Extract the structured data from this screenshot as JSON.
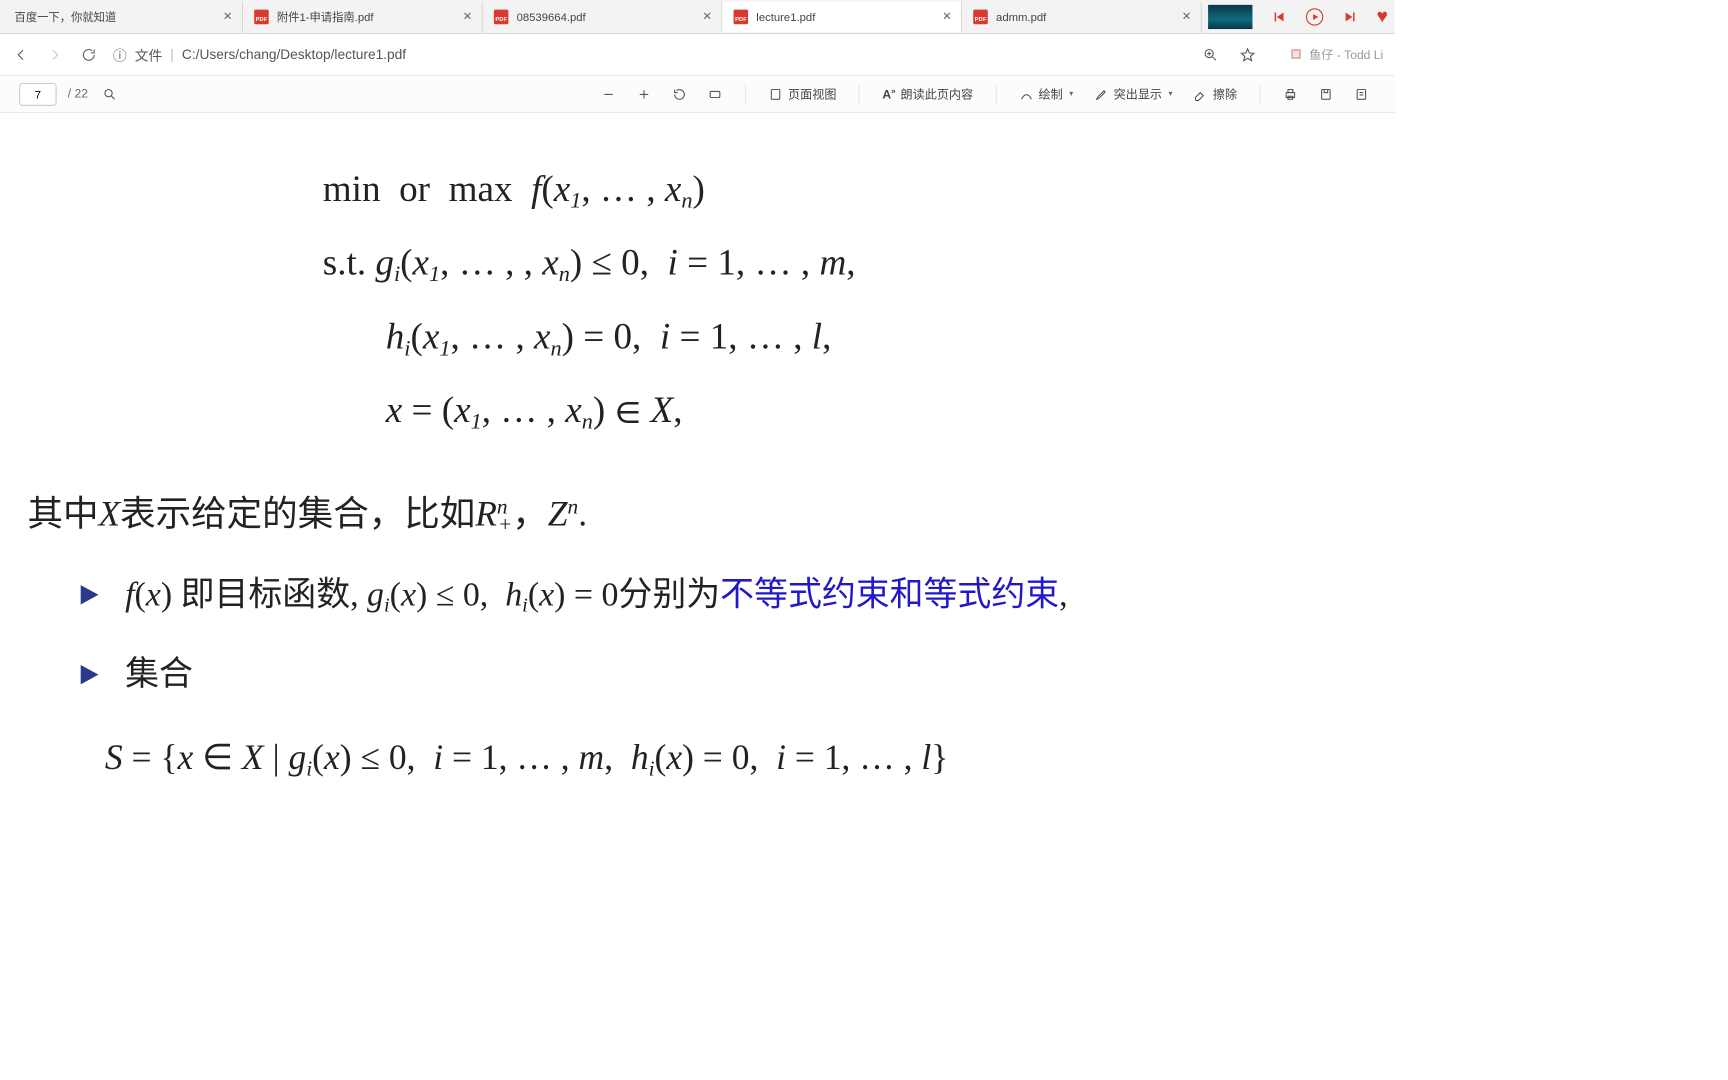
{
  "tabs": [
    {
      "label": "百度一下，你就知道",
      "has_pdf_icon": false
    },
    {
      "label": "附件1-申请指南.pdf",
      "has_pdf_icon": true
    },
    {
      "label": "08539664.pdf",
      "has_pdf_icon": true
    },
    {
      "label": "lecture1.pdf",
      "has_pdf_icon": true,
      "active": true
    },
    {
      "label": "admm.pdf",
      "has_pdf_icon": true
    }
  ],
  "address": {
    "info_label": "文件",
    "url": "C:/Users/chang/Desktop/lecture1.pdf"
  },
  "music": {
    "title": "鱼仔",
    "artist": "Todd Li"
  },
  "pdf_toolbar": {
    "page": "7",
    "page_count": "/ 22",
    "page_view": "页面视图",
    "read_aloud": "朗读此页内容",
    "draw": "绘制",
    "highlight": "突出显示",
    "erase": "擦除"
  },
  "content": {
    "math": [
      "min  or  max  f(x₁, … , xₙ)",
      "s.t.  gᵢ(x₁, … , , xₙ) ≤ 0,  i = 1, … , m,",
      "hᵢ(x₁, … , xₙ) = 0,  i = 1, … , l,",
      "x = (x₁, … , xₙ) ∈ X,"
    ],
    "para1_pre": "其中",
    "para1_mid": "表示给定的集合，比如",
    "bullet1_a": " 即目标函数, ",
    "bullet1_b": "分别为",
    "bullet1_c": "不等式约束和等式约束",
    "bullet2": "集合",
    "setline": "S = {x ∈ X | gᵢ(x) ≤ 0,  i = 1, … , m,  hᵢ(x) = 0,  i = 1, … , l}"
  }
}
